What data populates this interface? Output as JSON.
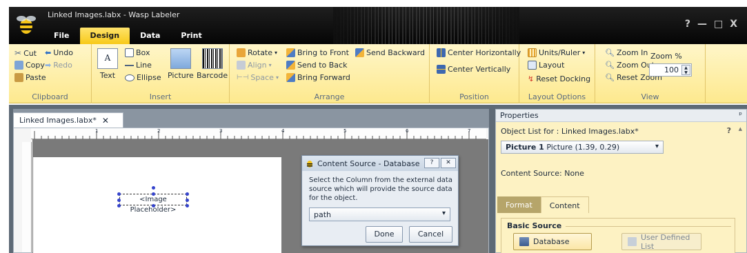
{
  "window": {
    "title": "Linked Images.labx - Wasp Labeler",
    "controls": [
      "?",
      "—",
      "□",
      "X"
    ]
  },
  "tabs": [
    {
      "label": "File"
    },
    {
      "label": "Design"
    },
    {
      "label": "Data"
    },
    {
      "label": "Print"
    }
  ],
  "ribbon": {
    "clipboard": {
      "cut": "Cut",
      "undo": "Undo",
      "copy": "Copy",
      "redo": "Redo",
      "paste": "Paste",
      "label": "Clipboard"
    },
    "insert": {
      "text": "Text",
      "box": "Box",
      "line": "Line",
      "ellipse": "Ellipse",
      "picture": "Picture",
      "barcode": "Barcode",
      "label": "Insert"
    },
    "arrange": {
      "rotate": "Rotate",
      "align": "Align",
      "space": "Space",
      "bring_front": "Bring to Front",
      "send_back": "Send to Back",
      "bring_forward": "Bring Forward",
      "send_backward": "Send Backward",
      "label": "Arrange"
    },
    "position": {
      "center_h": "Center Horizontally",
      "center_v": "Center Vertically",
      "label": "Position"
    },
    "layout_options": {
      "units": "Units/Ruler",
      "layout": "Layout",
      "reset_docking": "Reset Docking",
      "label": "Layout Options"
    },
    "view": {
      "zoom_in": "Zoom In",
      "zoom_out": "Zoom Out",
      "reset_zoom": "Reset Zoom",
      "zoom_label": "Zoom %",
      "zoom_value": "100",
      "label": "View"
    }
  },
  "document": {
    "tab": "Linked Images.labx*",
    "placeholder": "<Image Placeholder>",
    "ruler_marks": [
      "1",
      "2",
      "3",
      "4",
      "5",
      "6",
      "7"
    ]
  },
  "dialog": {
    "title": "Content Source - Database",
    "help": "?",
    "close": "✕",
    "message": "Select the Column from the external data source which will provide the source data for the object.",
    "selected": "path",
    "done": "Done",
    "cancel": "Cancel"
  },
  "properties": {
    "title": "Properties",
    "object_list_label": "Object List for :  Linked Images.labx*",
    "selected_object_name": "Picture 1",
    "selected_object_detail": "Picture (1.39, 0.29)",
    "content_source": "Content Source: None",
    "tabs": [
      "Format",
      "Content"
    ],
    "basic_source": "Basic Source",
    "database_button": "Database",
    "user_defined_button": "User Defined List"
  }
}
